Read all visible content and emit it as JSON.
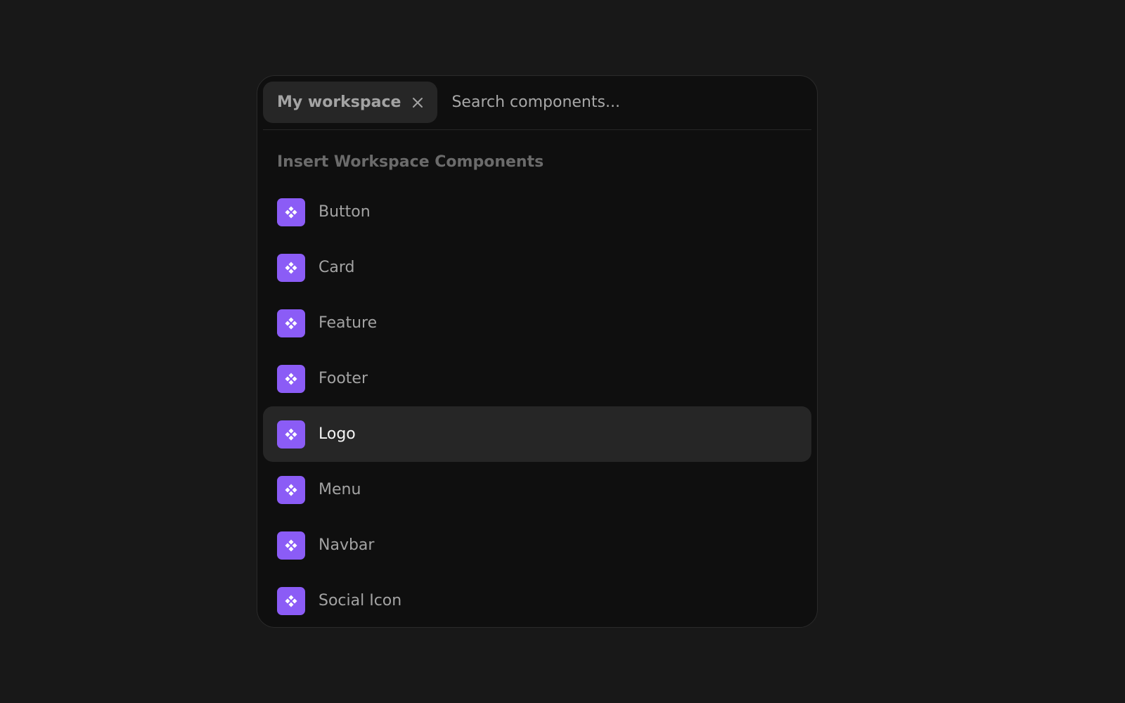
{
  "search": {
    "chip_label": "My workspace",
    "placeholder": "Search components...",
    "value": ""
  },
  "section_title": "Insert Workspace Components",
  "items": [
    {
      "label": "Button",
      "icon": "component-icon",
      "active": false
    },
    {
      "label": "Card",
      "icon": "component-icon",
      "active": false
    },
    {
      "label": "Feature",
      "icon": "component-icon",
      "active": false
    },
    {
      "label": "Footer",
      "icon": "component-icon",
      "active": false
    },
    {
      "label": "Logo",
      "icon": "component-icon",
      "active": true
    },
    {
      "label": "Menu",
      "icon": "component-icon",
      "active": false
    },
    {
      "label": "Navbar",
      "icon": "component-icon",
      "active": false
    },
    {
      "label": "Social Icon",
      "icon": "component-icon",
      "active": false
    }
  ],
  "colors": {
    "background": "#181818",
    "panel": "#0f0f0f",
    "accent": "#8b5cf6",
    "highlight": "#262626"
  }
}
